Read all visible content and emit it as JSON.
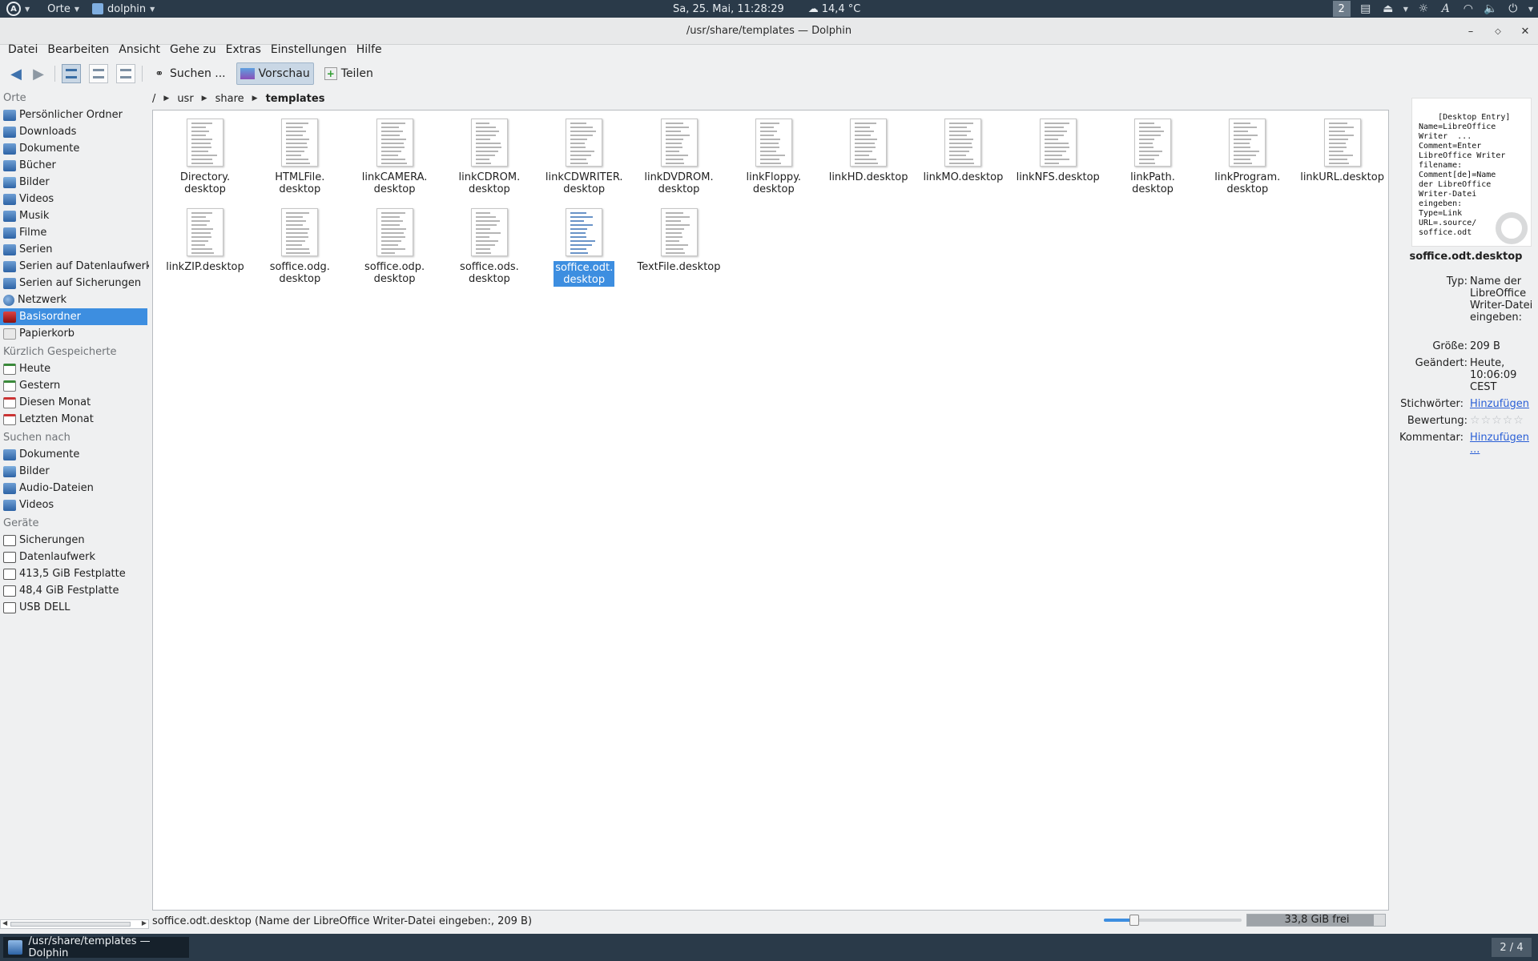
{
  "top_panel": {
    "places_menu": "Orte",
    "app_menu": "dolphin",
    "clock": "Sa, 25. Mai, 11:28:29",
    "weather": "14,4 °C",
    "desktop_number": "2"
  },
  "window": {
    "title": "/usr/share/templates — Dolphin"
  },
  "menubar": [
    "Datei",
    "Bearbeiten",
    "Ansicht",
    "Gehe zu",
    "Extras",
    "Einstellungen",
    "Hilfe"
  ],
  "toolbar": {
    "search_label": "Suchen ...",
    "preview_label": "Vorschau",
    "share_label": "Teilen"
  },
  "sidebar": {
    "sections": [
      {
        "title": "Orte",
        "items": [
          {
            "label": "Persönlicher Ordner",
            "icon": "folder-home-icon"
          },
          {
            "label": "Downloads",
            "icon": "folder-downloads-icon"
          },
          {
            "label": "Dokumente",
            "icon": "folder-documents-icon"
          },
          {
            "label": "Bücher",
            "icon": "folder-books-icon"
          },
          {
            "label": "Bilder",
            "icon": "folder-pictures-icon"
          },
          {
            "label": "Videos",
            "icon": "folder-videos-icon"
          },
          {
            "label": "Musik",
            "icon": "folder-music-icon"
          },
          {
            "label": "Filme",
            "icon": "folder-movies-icon"
          },
          {
            "label": "Serien",
            "icon": "folder-series-icon"
          },
          {
            "label": "Serien auf Datenlaufwerk",
            "icon": "folder-drive-icon"
          },
          {
            "label": "Serien auf Sicherungen",
            "icon": "folder-backup-icon"
          },
          {
            "label": "Netzwerk",
            "icon": "network-icon"
          },
          {
            "label": "Basisordner",
            "icon": "root-folder-icon"
          },
          {
            "label": "Papierkorb",
            "icon": "trash-icon"
          }
        ]
      },
      {
        "title": "Kürzlich Gespeicherte",
        "items": [
          {
            "label": "Heute",
            "icon": "calendar-today-icon"
          },
          {
            "label": "Gestern",
            "icon": "calendar-yesterday-icon"
          },
          {
            "label": "Diesen Monat",
            "icon": "calendar-month-icon"
          },
          {
            "label": "Letzten Monat",
            "icon": "calendar-last-month-icon"
          }
        ]
      },
      {
        "title": "Suchen nach",
        "items": [
          {
            "label": "Dokumente",
            "icon": "search-documents-icon"
          },
          {
            "label": "Bilder",
            "icon": "search-images-icon"
          },
          {
            "label": "Audio-Dateien",
            "icon": "search-audio-icon"
          },
          {
            "label": "Videos",
            "icon": "search-videos-icon"
          }
        ]
      },
      {
        "title": "Geräte",
        "items": [
          {
            "label": "Sicherungen",
            "icon": "drive-icon"
          },
          {
            "label": "Datenlaufwerk",
            "icon": "drive-icon"
          },
          {
            "label": "413,5 GiB Festplatte",
            "icon": "drive-icon"
          },
          {
            "label": "48,4 GiB Festplatte",
            "icon": "drive-icon"
          },
          {
            "label": "USB DELL",
            "icon": "usb-drive-icon"
          }
        ]
      }
    ],
    "selected": "Basisordner"
  },
  "breadcrumb": [
    "/",
    "usr",
    "share",
    "templates"
  ],
  "files": [
    {
      "name": "Directory.\ndesktop"
    },
    {
      "name": "HTMLFile.\ndesktop"
    },
    {
      "name": "linkCAMERA.\ndesktop"
    },
    {
      "name": "linkCDROM.\ndesktop"
    },
    {
      "name": "linkCDWRITER.\ndesktop"
    },
    {
      "name": "linkDVDROM.\ndesktop"
    },
    {
      "name": "linkFloppy.\ndesktop"
    },
    {
      "name": "linkHD.desktop"
    },
    {
      "name": "linkMO.desktop"
    },
    {
      "name": "linkNFS.desktop"
    },
    {
      "name": "linkPath.\ndesktop"
    },
    {
      "name": "linkProgram.\ndesktop"
    },
    {
      "name": "linkURL.desktop"
    },
    {
      "name": "linkZIP.desktop"
    },
    {
      "name": "soffice.odg.\ndesktop"
    },
    {
      "name": "soffice.odp.\ndesktop"
    },
    {
      "name": "soffice.ods.\ndesktop"
    },
    {
      "name": "soffice.odt.\ndesktop",
      "selected": true
    },
    {
      "name": "TextFile.desktop"
    }
  ],
  "info_panel": {
    "preview_text": "[Desktop Entry]\nName=LibreOffice\nWriter  ...\nComment=Enter\nLibreOffice Writer\nfilename:\nComment[de]=Name\nder LibreOffice\nWriter-Datei\neingeben:\nType=Link\nURL=.source/\nsoffice.odt",
    "filename": "soffice.odt.desktop",
    "type_key": "Typ:",
    "type_value": "Name der LibreOffice Writer-Datei eingeben:",
    "size_key": "Größe:",
    "size_value": "209 B",
    "modified_key": "Geändert:",
    "modified_value": "Heute, 10:06:09 CEST",
    "tags_key": "Stichwörter:",
    "tags_link": "Hinzufügen",
    "rating_key": "Bewertung:",
    "rating_value": 0,
    "rating_max": 5,
    "comment_key": "Kommentar:",
    "comment_link": "Hinzufügen ..."
  },
  "statusbar": {
    "text": "soffice.odt.desktop (Name der LibreOffice Writer-Datei eingeben:, 209 B)",
    "zoom_fraction": 0.22,
    "free_space": "33,8 GiB frei",
    "used_fraction": 0.92
  },
  "taskbar": {
    "task_title": "/usr/share/templates — Dolphin",
    "pager": "2 / 4"
  }
}
